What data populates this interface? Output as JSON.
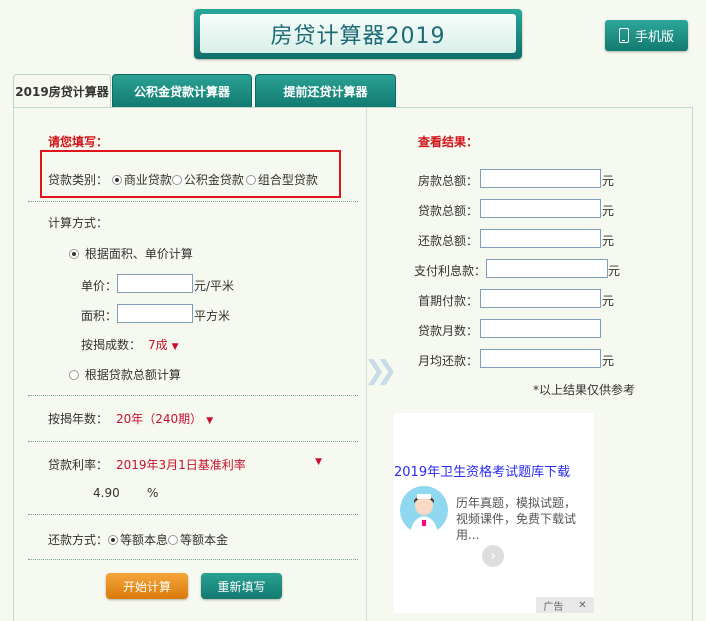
{
  "header": {
    "title": "房贷计算器2019",
    "mobile_label": "手机版"
  },
  "tabs": [
    "2019房贷计算器",
    "公积金贷款计算器",
    "提前还贷计算器"
  ],
  "form": {
    "fill_hint": "请您填写：",
    "loan_type_label": "贷款类别：",
    "loan_types": [
      "商业贷款",
      "公积金贷款",
      "组合型贷款"
    ],
    "calc_method_label": "计算方式：",
    "method_area": "根据面积、单价计算",
    "unit_price_label": "单价：",
    "unit_price_unit": "元/平米",
    "area_label": "面积：",
    "area_unit": "平方米",
    "mortgage_ratio_label": "按揭成数：",
    "mortgage_ratio_value": "7成",
    "method_total": "根据贷款总额计算",
    "years_label": "按揭年数：",
    "years_value": "20年（240期）",
    "rate_label": "贷款利率：",
    "rate_value": "2019年3月1日基准利率",
    "rate_number": "4.90",
    "rate_unit": "%",
    "repay_label": "还款方式：",
    "repay_options": [
      "等额本息",
      "等额本金"
    ],
    "start_button": "开始计算",
    "reset_button": "重新填写"
  },
  "results": {
    "title": "查看结果：",
    "rows": [
      {
        "label": "房款总额：",
        "unit": "元"
      },
      {
        "label": "贷款总额：",
        "unit": "元"
      },
      {
        "label": "还款总额：",
        "unit": "元"
      },
      {
        "label": "支付利息款：",
        "unit": "元"
      },
      {
        "label": "首期付款：",
        "unit": "元"
      },
      {
        "label": "贷款月数：",
        "unit": ""
      },
      {
        "label": "月均还款：",
        "unit": "元"
      }
    ],
    "note": "*以上结果仅供参考"
  },
  "ad": {
    "title": "2019年卫生资格考试题库下载",
    "text": "历年真题，模拟试题，视频课件，免费下载试用...",
    "tag": "广告"
  }
}
